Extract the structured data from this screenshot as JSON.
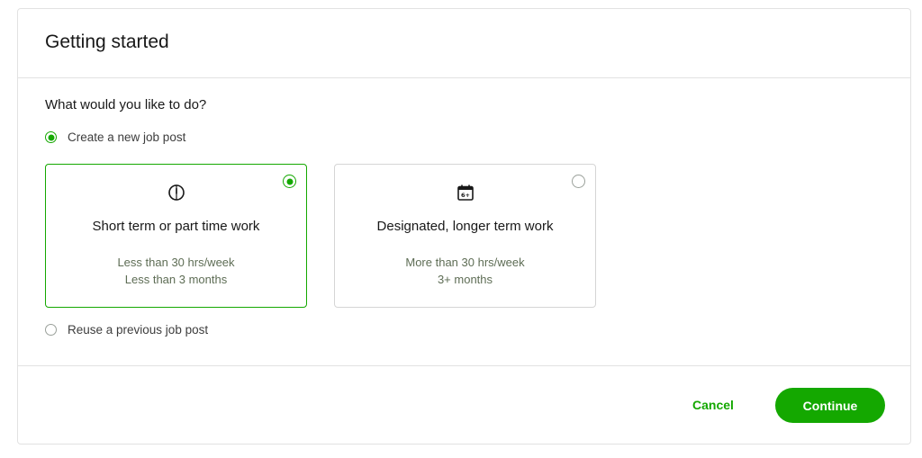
{
  "dialog": {
    "title": "Getting started",
    "question": "What would you like to do?"
  },
  "options": {
    "create_new": {
      "label": "Create a new job post",
      "checked": true
    },
    "reuse_previous": {
      "label": "Reuse a previous job post",
      "checked": false
    }
  },
  "cards": [
    {
      "icon": "clock-icon",
      "title": "Short term or part time work",
      "line1": "Less than 30 hrs/week",
      "line2": "Less than 3 months",
      "selected": true
    },
    {
      "icon": "calendar-icon",
      "title": "Designated, longer term work",
      "line1": "More than 30 hrs/week",
      "line2": "3+ months",
      "icon_text": "6+",
      "selected": false
    }
  ],
  "footer": {
    "cancel_label": "Cancel",
    "continue_label": "Continue"
  },
  "colors": {
    "accent": "#14a800",
    "border": "#e2e2e2",
    "text": "#181818",
    "muted": "#5e6d55"
  }
}
